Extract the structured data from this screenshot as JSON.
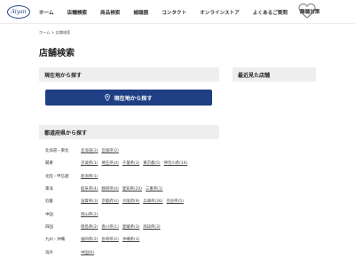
{
  "header": {
    "logo_text": "Aiyan",
    "nav": [
      {
        "label": "ホーム"
      },
      {
        "label": "店舗検索"
      },
      {
        "label": "商品検索"
      },
      {
        "label": "補聴器"
      },
      {
        "label": "コンタクト"
      },
      {
        "label": "オンラインストア"
      },
      {
        "label": "よくあるご質問"
      }
    ],
    "heart_label": "難聴対策"
  },
  "breadcrumb": "ホーム > 店舗検索",
  "page_title": "店舗検索",
  "locate": {
    "heading": "現在地から探す",
    "button_label": "現在地から探す",
    "accent": "#1e3f83"
  },
  "recent": {
    "heading": "最近見た店舗"
  },
  "prefectures": {
    "heading": "都道府県から探す",
    "rows": [
      {
        "region": "北海道・東北",
        "prefs": [
          "北海道(3)",
          "宮城県(2)"
        ]
      },
      {
        "region": "関東",
        "prefs": [
          "茨城県(1)",
          "埼玉県(4)",
          "千葉県(3)",
          "東京都(5)",
          "神奈川県(16)"
        ]
      },
      {
        "region": "北陸・甲信越",
        "prefs": [
          "新潟県(1)"
        ]
      },
      {
        "region": "東海",
        "prefs": [
          "岐阜県(4)",
          "静岡県(4)",
          "愛知県(24)",
          "三重県(1)"
        ]
      },
      {
        "region": "近畿",
        "prefs": [
          "滋賀県(3)",
          "京都府(4)",
          "大阪府(9)",
          "兵庫県(26)",
          "奈良県(5)"
        ]
      },
      {
        "region": "中国",
        "prefs": [
          "岡山県(2)"
        ]
      },
      {
        "region": "四国",
        "prefs": [
          "徳島県(2)",
          "香川県(1)",
          "愛媛県(3)",
          "高知県(3)"
        ]
      },
      {
        "region": "九州・沖縄",
        "prefs": [
          "福岡県(2)",
          "長崎県(2)",
          "沖縄県(3)"
        ]
      },
      {
        "region": "海外",
        "prefs": [
          "中国(6)"
        ]
      }
    ]
  }
}
